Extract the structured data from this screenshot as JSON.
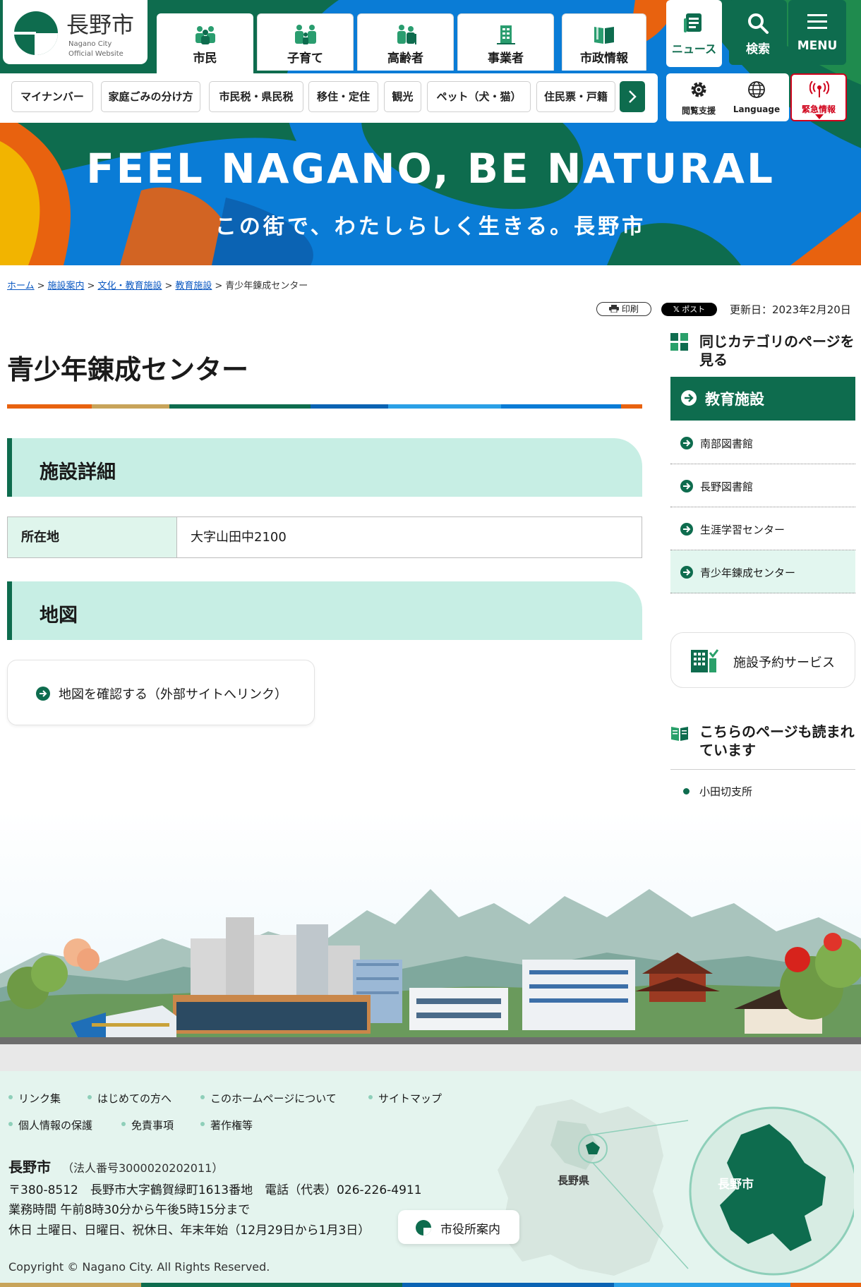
{
  "header": {
    "logo_name": "長野市",
    "logo_sub_1": "Nagano City",
    "logo_sub_2": "Official Website",
    "nav": [
      "市民",
      "子育て",
      "高齢者",
      "事業者",
      "市政情報"
    ],
    "news": "ニュース",
    "search": "検索",
    "menu": "MENU",
    "quick_links": [
      "マイナンバー",
      "家庭ごみの分け方",
      "市民税・県民税",
      "移住・定住",
      "観光",
      "ペット（犬・猫）",
      "住民票・戸籍"
    ],
    "browse_support": "閲覧支援",
    "language": "Language",
    "emergency": "緊急情報"
  },
  "hero": {
    "catch_en": "FEEL NAGANO, BE NATURAL",
    "catch_ja": "この街で、わたしらしく生きる。長野市"
  },
  "breadcrumb": {
    "items": [
      "ホーム",
      "施設案内",
      "文化・教育施設",
      "教育施設"
    ],
    "current": "青少年錬成センター",
    "separator": ">"
  },
  "tools": {
    "print": "印刷",
    "post": "ポスト",
    "updated": "更新日：2023年2月20日"
  },
  "main": {
    "title": "青少年錬成センター",
    "section_detail": "施設詳細",
    "address_label": "所在地",
    "address_value": "大字山田中2100",
    "section_map": "地図",
    "map_link": "地図を確認する（外部サイトへリンク）"
  },
  "sidebar": {
    "same_category": "同じカテゴリのページを見る",
    "category": "教育施設",
    "items": [
      "南部図書館",
      "長野図書館",
      "生涯学習センター",
      "青少年錬成センター"
    ],
    "reservation": "施設予約サービス",
    "also_read": "こちらのページも読まれています",
    "related": [
      "小田切支所"
    ]
  },
  "footer": {
    "links_row1": [
      "リンク集",
      "はじめての方へ",
      "このホームページについて",
      "サイトマップ"
    ],
    "links_row2": [
      "個人情報の保護",
      "免責事項",
      "著作権等"
    ],
    "city": "長野市",
    "corp_no": "（法人番号3000020202011）",
    "address": "〒380-8512　長野市大字鶴賀緑町1613番地　電話（代表）026-226-4911",
    "hours": "業務時間 午前8時30分から午後5時15分まで",
    "holidays": "休日 土曜日、日曜日、祝休日、年末年始（12月29日から1月3日）",
    "city_hall": "市役所案内",
    "map_pref": "長野県",
    "map_city": "長野市",
    "copyright": "Copyright © Nagano City. All Rights Reserved."
  },
  "colors": {
    "brand_green": "#0e6c4e",
    "light_green": "#c7eee4",
    "hero_blue": "#0a7cd6",
    "hero_orange": "#e8620f",
    "emergency_red": "#d0021b"
  }
}
